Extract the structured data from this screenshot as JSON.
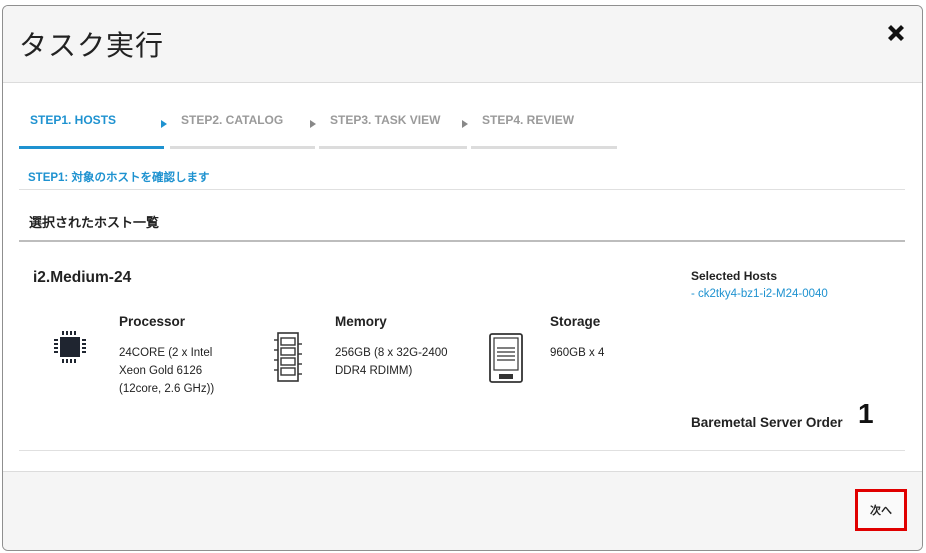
{
  "dialog": {
    "title": "タスク実行"
  },
  "steps": [
    {
      "label": "STEP1. HOSTS",
      "active": true
    },
    {
      "label": "STEP2. CATALOG",
      "active": false
    },
    {
      "label": "STEP3. TASK VIEW",
      "active": false
    },
    {
      "label": "STEP4. REVIEW",
      "active": false
    }
  ],
  "step_caption": "STEP1: 対象のホストを確認します",
  "section_title": "選択されたホスト一覧",
  "plan": {
    "name": "i2.Medium-24",
    "processor": {
      "title": "Processor",
      "lines": [
        "24CORE (2 x Intel",
        "Xeon Gold 6126",
        "(12core, 2.6 GHz))"
      ]
    },
    "memory": {
      "title": "Memory",
      "lines": [
        "256GB (8 x 32G-2400",
        "DDR4 RDIMM)"
      ]
    },
    "storage": {
      "title": "Storage",
      "lines": [
        "960GB x 4"
      ]
    }
  },
  "selected_hosts": {
    "title": "Selected Hosts",
    "items": [
      "-  ck2tky4-bz1-i2-M24-0040"
    ]
  },
  "order": {
    "label": "Baremetal Server Order",
    "count": "1"
  },
  "footer": {
    "next_label": "次へ"
  },
  "colors": {
    "accent": "#1e92d0",
    "highlight_border": "#e00000"
  }
}
